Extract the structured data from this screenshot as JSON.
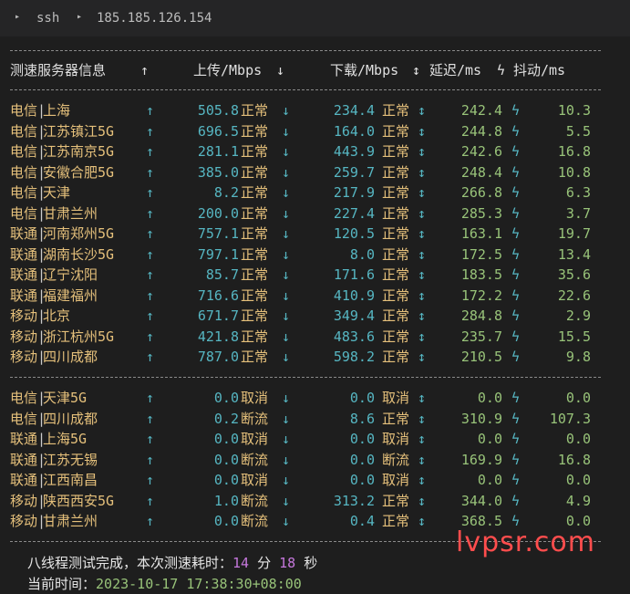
{
  "tabs": {
    "first_label": "ssh",
    "second_label": "185.185.126.154"
  },
  "header": {
    "server": "测速服务器信息",
    "upload": "上传/Mbps",
    "download": "下载/Mbps",
    "latency": "延迟/ms",
    "jitter": "抖动/ms",
    "icon_up": "↑",
    "icon_down": "↓",
    "icon_updown": "↕",
    "icon_bolt": "ϟ"
  },
  "group1": [
    {
      "isp": "电信",
      "city": "上海",
      "up": "505.8",
      "up_status": "正常",
      "down": "234.4",
      "down_status": "正常",
      "latency": "242.4",
      "jitter": "10.3"
    },
    {
      "isp": "电信",
      "city": "江苏镇江5G",
      "up": "696.5",
      "up_status": "正常",
      "down": "164.0",
      "down_status": "正常",
      "latency": "244.8",
      "jitter": "5.5"
    },
    {
      "isp": "电信",
      "city": "江苏南京5G",
      "up": "281.1",
      "up_status": "正常",
      "down": "443.9",
      "down_status": "正常",
      "latency": "242.6",
      "jitter": "16.8"
    },
    {
      "isp": "电信",
      "city": "安徽合肥5G",
      "up": "385.0",
      "up_status": "正常",
      "down": "259.7",
      "down_status": "正常",
      "latency": "248.4",
      "jitter": "10.8"
    },
    {
      "isp": "电信",
      "city": "天津",
      "up": "8.2",
      "up_status": "正常",
      "down": "217.9",
      "down_status": "正常",
      "latency": "266.8",
      "jitter": "6.3"
    },
    {
      "isp": "电信",
      "city": "甘肃兰州",
      "up": "200.0",
      "up_status": "正常",
      "down": "227.4",
      "down_status": "正常",
      "latency": "285.3",
      "jitter": "3.7"
    },
    {
      "isp": "联通",
      "city": "河南郑州5G",
      "up": "757.1",
      "up_status": "正常",
      "down": "120.5",
      "down_status": "正常",
      "latency": "163.1",
      "jitter": "19.7"
    },
    {
      "isp": "联通",
      "city": "湖南长沙5G",
      "up": "797.1",
      "up_status": "正常",
      "down": "8.0",
      "down_status": "正常",
      "latency": "172.5",
      "jitter": "13.4"
    },
    {
      "isp": "联通",
      "city": "辽宁沈阳",
      "up": "85.7",
      "up_status": "正常",
      "down": "171.6",
      "down_status": "正常",
      "latency": "183.5",
      "jitter": "35.6"
    },
    {
      "isp": "联通",
      "city": "福建福州",
      "up": "716.6",
      "up_status": "正常",
      "down": "410.9",
      "down_status": "正常",
      "latency": "172.2",
      "jitter": "22.6"
    },
    {
      "isp": "移动",
      "city": "北京",
      "up": "671.7",
      "up_status": "正常",
      "down": "349.4",
      "down_status": "正常",
      "latency": "284.8",
      "jitter": "2.9"
    },
    {
      "isp": "移动",
      "city": "浙江杭州5G",
      "up": "421.8",
      "up_status": "正常",
      "down": "483.6",
      "down_status": "正常",
      "latency": "235.7",
      "jitter": "15.5"
    },
    {
      "isp": "移动",
      "city": "四川成都",
      "up": "787.0",
      "up_status": "正常",
      "down": "598.2",
      "down_status": "正常",
      "latency": "210.5",
      "jitter": "9.8"
    }
  ],
  "group2": [
    {
      "isp": "电信",
      "city": "天津5G",
      "up": "0.0",
      "up_status": "取消",
      "down": "0.0",
      "down_status": "取消",
      "latency": "0.0",
      "jitter": "0.0"
    },
    {
      "isp": "电信",
      "city": "四川成都",
      "up": "0.2",
      "up_status": "断流",
      "down": "8.6",
      "down_status": "正常",
      "latency": "310.9",
      "jitter": "107.3"
    },
    {
      "isp": "联通",
      "city": "上海5G",
      "up": "0.0",
      "up_status": "取消",
      "down": "0.0",
      "down_status": "取消",
      "latency": "0.0",
      "jitter": "0.0"
    },
    {
      "isp": "联通",
      "city": "江苏无锡",
      "up": "0.0",
      "up_status": "断流",
      "down": "0.0",
      "down_status": "断流",
      "latency": "169.9",
      "jitter": "16.8"
    },
    {
      "isp": "联通",
      "city": "江西南昌",
      "up": "0.0",
      "up_status": "取消",
      "down": "0.0",
      "down_status": "取消",
      "latency": "0.0",
      "jitter": "0.0"
    },
    {
      "isp": "移动",
      "city": "陕西西安5G",
      "up": "1.0",
      "up_status": "断流",
      "down": "313.2",
      "down_status": "正常",
      "latency": "344.0",
      "jitter": "4.9"
    },
    {
      "isp": "移动",
      "city": "甘肃兰州",
      "up": "0.0",
      "up_status": "断流",
      "down": "0.4",
      "down_status": "正常",
      "latency": "368.5",
      "jitter": "0.0"
    }
  ],
  "footer": {
    "done_prefix": "八线程测试完成，本次测速耗时：",
    "minutes": "14",
    "min_unit": " 分 ",
    "seconds": "18",
    "sec_unit": " 秒",
    "time_label": "当前时间：",
    "time_value": "2023-10-17 17:38:30+08:00"
  },
  "watermark": "lvpsr.com"
}
